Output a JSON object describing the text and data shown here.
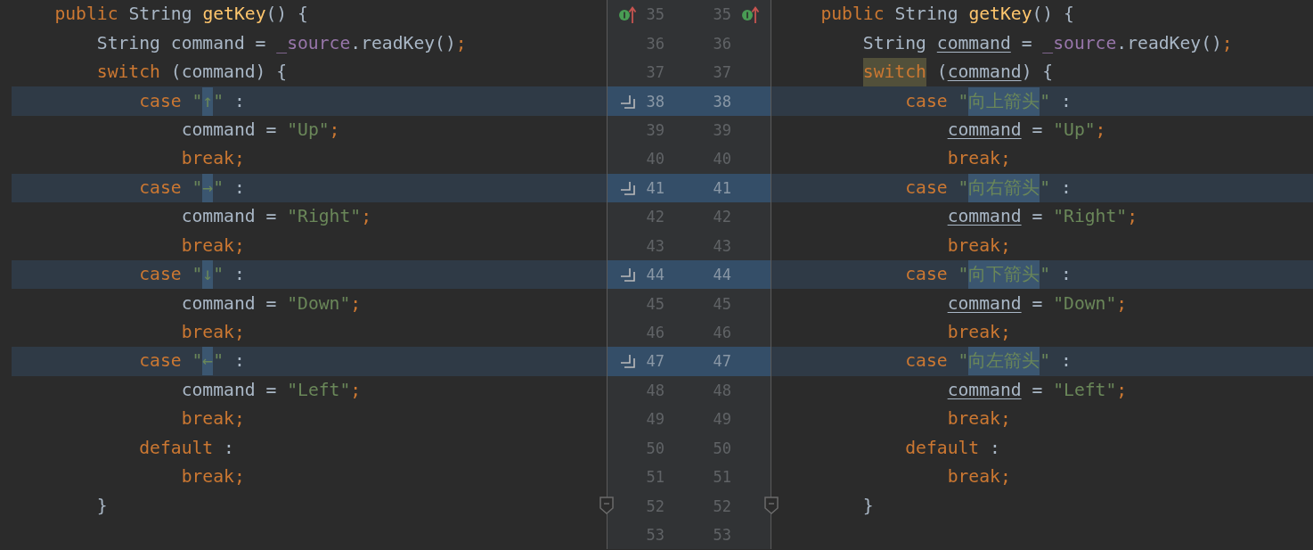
{
  "diff": {
    "rows": [
      {
        "left_number": "35",
        "right_number": "35",
        "changed": false,
        "current": false,
        "left_marker": {
          "kind": "override"
        },
        "right_marker": {
          "kind": "override"
        },
        "left": [
          {
            "kind": "keyword",
            "text": "    public "
          },
          {
            "kind": "plain",
            "text": "String "
          },
          {
            "kind": "method",
            "text": "getKey"
          },
          {
            "kind": "plain",
            "text": "() {"
          }
        ],
        "right": [
          {
            "kind": "keyword",
            "text": "    public "
          },
          {
            "kind": "plain",
            "text": "String "
          },
          {
            "kind": "method",
            "text": "getKey"
          },
          {
            "kind": "plain",
            "text": "() {"
          }
        ]
      },
      {
        "left_number": "36",
        "right_number": "36",
        "changed": false,
        "current": false,
        "left": [
          {
            "kind": "plain",
            "text": "        String command = "
          },
          {
            "kind": "field",
            "text": "_source"
          },
          {
            "kind": "plain",
            "text": ".readKey()"
          },
          {
            "kind": "keyword",
            "text": ";"
          }
        ],
        "right": [
          {
            "kind": "plain",
            "text": "        String "
          },
          {
            "kind": "local",
            "text": "command"
          },
          {
            "kind": "plain",
            "text": " = "
          },
          {
            "kind": "field",
            "text": "_source"
          },
          {
            "kind": "plain",
            "text": ".readKey()"
          },
          {
            "kind": "keyword",
            "text": ";"
          }
        ]
      },
      {
        "left_number": "37",
        "right_number": "37",
        "changed": false,
        "current": false,
        "left": [
          {
            "kind": "keyword",
            "text": "        switch "
          },
          {
            "kind": "plain",
            "text": "(command) {"
          }
        ],
        "right": [
          {
            "kind": "marked",
            "text": "        switch"
          },
          {
            "kind": "plain",
            "text": " ("
          },
          {
            "kind": "local",
            "text": "command"
          },
          {
            "kind": "plain",
            "text": ") {"
          }
        ]
      },
      {
        "left_number": "38",
        "right_number": "38",
        "changed": true,
        "current": true,
        "left_marker": {
          "kind": "changed"
        },
        "left": [
          {
            "kind": "keyword",
            "text": "            case "
          },
          {
            "kind": "string",
            "text": "\""
          },
          {
            "kind": "changed",
            "text": "↑"
          },
          {
            "kind": "string",
            "text": "\""
          },
          {
            "kind": "plain",
            "text": " :"
          }
        ],
        "right": [
          {
            "kind": "keyword",
            "text": "            case "
          },
          {
            "kind": "string",
            "text": "\""
          },
          {
            "kind": "changed",
            "text": "向上箭头"
          },
          {
            "kind": "string",
            "text": "\""
          },
          {
            "kind": "plain",
            "text": " :"
          }
        ]
      },
      {
        "left_number": "39",
        "right_number": "39",
        "changed": false,
        "current": false,
        "left": [
          {
            "kind": "plain",
            "text": "                command = "
          },
          {
            "kind": "string",
            "text": "\"Up\""
          },
          {
            "kind": "keyword",
            "text": ";"
          }
        ],
        "right": [
          {
            "kind": "local",
            "text": "                command"
          },
          {
            "kind": "plain",
            "text": " = "
          },
          {
            "kind": "string",
            "text": "\"Up\""
          },
          {
            "kind": "keyword",
            "text": ";"
          }
        ]
      },
      {
        "left_number": "40",
        "right_number": "40",
        "changed": false,
        "current": false,
        "left": [
          {
            "kind": "keyword",
            "text": "                break;"
          }
        ],
        "right": [
          {
            "kind": "keyword",
            "text": "                break;"
          }
        ]
      },
      {
        "left_number": "41",
        "right_number": "41",
        "changed": true,
        "current": false,
        "left_marker": {
          "kind": "changed"
        },
        "left": [
          {
            "kind": "keyword",
            "text": "            case "
          },
          {
            "kind": "string",
            "text": "\""
          },
          {
            "kind": "changed",
            "text": "→"
          },
          {
            "kind": "string",
            "text": "\""
          },
          {
            "kind": "plain",
            "text": " :"
          }
        ],
        "right": [
          {
            "kind": "keyword",
            "text": "            case "
          },
          {
            "kind": "string",
            "text": "\""
          },
          {
            "kind": "changed",
            "text": "向右箭头"
          },
          {
            "kind": "string",
            "text": "\""
          },
          {
            "kind": "plain",
            "text": " :"
          }
        ]
      },
      {
        "left_number": "42",
        "right_number": "42",
        "changed": false,
        "current": false,
        "left": [
          {
            "kind": "plain",
            "text": "                command = "
          },
          {
            "kind": "string",
            "text": "\"Right\""
          },
          {
            "kind": "keyword",
            "text": ";"
          }
        ],
        "right": [
          {
            "kind": "local",
            "text": "                command"
          },
          {
            "kind": "plain",
            "text": " = "
          },
          {
            "kind": "string",
            "text": "\"Right\""
          },
          {
            "kind": "keyword",
            "text": ";"
          }
        ]
      },
      {
        "left_number": "43",
        "right_number": "43",
        "changed": false,
        "current": false,
        "left": [
          {
            "kind": "keyword",
            "text": "                break;"
          }
        ],
        "right": [
          {
            "kind": "keyword",
            "text": "                break;"
          }
        ]
      },
      {
        "left_number": "44",
        "right_number": "44",
        "changed": true,
        "current": false,
        "left_marker": {
          "kind": "changed"
        },
        "left": [
          {
            "kind": "keyword",
            "text": "            case "
          },
          {
            "kind": "string",
            "text": "\""
          },
          {
            "kind": "changed",
            "text": "↓"
          },
          {
            "kind": "string",
            "text": "\""
          },
          {
            "kind": "plain",
            "text": " :"
          }
        ],
        "right": [
          {
            "kind": "keyword",
            "text": "            case "
          },
          {
            "kind": "string",
            "text": "\""
          },
          {
            "kind": "changed",
            "text": "向下箭头"
          },
          {
            "kind": "string",
            "text": "\""
          },
          {
            "kind": "plain",
            "text": " :"
          }
        ]
      },
      {
        "left_number": "45",
        "right_number": "45",
        "changed": false,
        "current": false,
        "left": [
          {
            "kind": "plain",
            "text": "                command = "
          },
          {
            "kind": "string",
            "text": "\"Down\""
          },
          {
            "kind": "keyword",
            "text": ";"
          }
        ],
        "right": [
          {
            "kind": "local",
            "text": "                command"
          },
          {
            "kind": "plain",
            "text": " = "
          },
          {
            "kind": "string",
            "text": "\"Down\""
          },
          {
            "kind": "keyword",
            "text": ";"
          }
        ]
      },
      {
        "left_number": "46",
        "right_number": "46",
        "changed": false,
        "current": false,
        "left": [
          {
            "kind": "keyword",
            "text": "                break;"
          }
        ],
        "right": [
          {
            "kind": "keyword",
            "text": "                break;"
          }
        ]
      },
      {
        "left_number": "47",
        "right_number": "47",
        "changed": true,
        "current": false,
        "left_marker": {
          "kind": "changed"
        },
        "left": [
          {
            "kind": "keyword",
            "text": "            case "
          },
          {
            "kind": "string",
            "text": "\""
          },
          {
            "kind": "changed",
            "text": "←"
          },
          {
            "kind": "string",
            "text": "\""
          },
          {
            "kind": "plain",
            "text": " :"
          }
        ],
        "right": [
          {
            "kind": "keyword",
            "text": "            case "
          },
          {
            "kind": "string",
            "text": "\""
          },
          {
            "kind": "changed",
            "text": "向左箭头"
          },
          {
            "kind": "string",
            "text": "\""
          },
          {
            "kind": "plain",
            "text": " :"
          }
        ]
      },
      {
        "left_number": "48",
        "right_number": "48",
        "changed": false,
        "current": false,
        "left": [
          {
            "kind": "plain",
            "text": "                command = "
          },
          {
            "kind": "string",
            "text": "\"Left\""
          },
          {
            "kind": "keyword",
            "text": ";"
          }
        ],
        "right": [
          {
            "kind": "local",
            "text": "                command"
          },
          {
            "kind": "plain",
            "text": " = "
          },
          {
            "kind": "string",
            "text": "\"Left\""
          },
          {
            "kind": "keyword",
            "text": ";"
          }
        ]
      },
      {
        "left_number": "49",
        "right_number": "49",
        "changed": false,
        "current": false,
        "left": [
          {
            "kind": "keyword",
            "text": "                break;"
          }
        ],
        "right": [
          {
            "kind": "keyword",
            "text": "                break;"
          }
        ]
      },
      {
        "left_number": "50",
        "right_number": "50",
        "changed": false,
        "current": false,
        "left": [
          {
            "kind": "keyword",
            "text": "            default"
          },
          {
            "kind": "plain",
            "text": " :"
          }
        ],
        "right": [
          {
            "kind": "keyword",
            "text": "            default"
          },
          {
            "kind": "plain",
            "text": " :"
          }
        ]
      },
      {
        "left_number": "51",
        "right_number": "51",
        "changed": false,
        "current": false,
        "left": [
          {
            "kind": "keyword",
            "text": "                break;"
          }
        ],
        "right": [
          {
            "kind": "keyword",
            "text": "                break;"
          }
        ]
      },
      {
        "left_number": "52",
        "right_number": "52",
        "changed": false,
        "current": false,
        "left_marker": {
          "kind": "fold"
        },
        "right_marker": {
          "kind": "fold"
        },
        "left": [
          {
            "kind": "plain",
            "text": "        }"
          }
        ],
        "right": [
          {
            "kind": "plain",
            "text": "        }"
          }
        ]
      },
      {
        "left_number": "53",
        "right_number": "53",
        "changed": false,
        "current": false
      }
    ]
  }
}
